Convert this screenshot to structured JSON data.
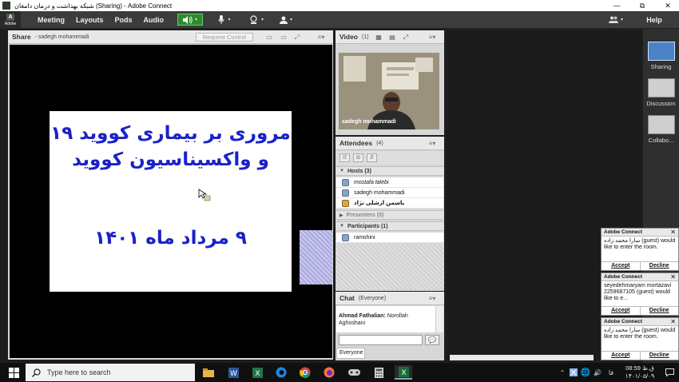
{
  "window": {
    "title": "شبکه بهداشت و درمان دامغان (Sharing) - Adobe Connect",
    "minimize": "—",
    "maximize": "⧉",
    "close": "✕"
  },
  "menubar": {
    "logo_mark": "A",
    "logo_text": "Adobe",
    "items": [
      "Meeting",
      "Layouts",
      "Pods",
      "Audio"
    ],
    "help": "Help"
  },
  "share_pod": {
    "title": "Share",
    "presenter": "- sadegh mohammadi",
    "request_control": "Request Control",
    "slide": {
      "line1": "مروری بر بیماری کووید ۱۹",
      "line2": "و واکسیناسیون کووید",
      "line3": "۹ مرداد ماه ۱۴۰۱"
    }
  },
  "video_pod": {
    "title": "Video",
    "count": "(1)",
    "name_label": "sadegh mohammadi"
  },
  "attendees_pod": {
    "title": "Attendees",
    "count": "(4)",
    "hosts_label": "Hosts (3)",
    "hosts": [
      "mostafa talebi",
      "sadegh mohammadi",
      "یاسمن ارشلی نژاد"
    ],
    "presenters_label": "Presenters (0)",
    "participants_label": "Participants (1)",
    "participants": [
      "ramshini"
    ]
  },
  "chat_pod": {
    "title": "Chat",
    "scope": "(Everyone)",
    "messages": [
      {
        "sender": "Ahmad Fathalian:",
        "text": "Norollah Aghoshani"
      }
    ],
    "tab": "Everyone"
  },
  "right_rail": {
    "items": [
      "Sharing",
      "Discussion",
      "Collabo..."
    ]
  },
  "notifications": [
    {
      "title": "Adobe Connect",
      "body": "سارا محمد زاده (guest) would like to enter the room.",
      "accept": "Accept",
      "decline": "Decline"
    },
    {
      "title": "Adobe Connect",
      "body": "seyedehmaryam mortazavi 2259687105 (guest) would like to e...",
      "accept": "Accept",
      "decline": "Decline"
    },
    {
      "title": "Adobe Connect",
      "body": "سارا محمد زاده (guest) would like to enter the room.",
      "accept": "Accept",
      "decline": "Decline"
    }
  ],
  "taskbar": {
    "search_placeholder": "Type here to search",
    "clock_time": "08:59 ق.ظ",
    "clock_date": "۱۴۰۱/۰۵/۰۹",
    "lang": "فا"
  }
}
